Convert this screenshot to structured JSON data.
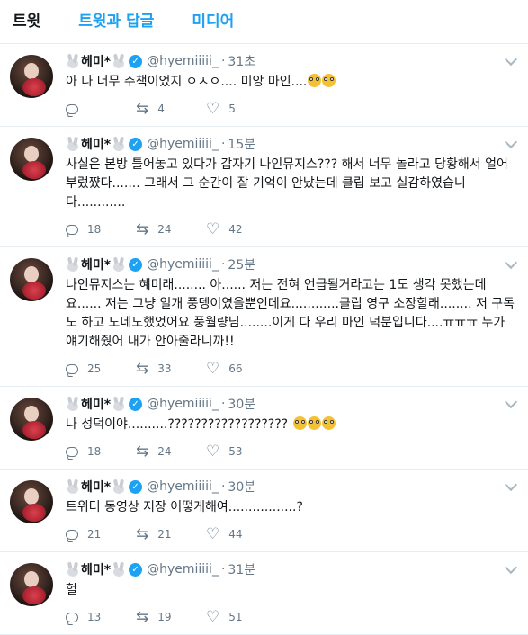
{
  "tabs": [
    "트윗",
    "트윗과 답글",
    "미디어"
  ],
  "user": {
    "name": "헤미*",
    "handle": "@hyemiiiii_"
  },
  "tweets": [
    {
      "time": "31초",
      "text": "아 나 너무 주책이었지 ㅇㅅㅇ.... 미앙 마인....",
      "emoji_count": 2,
      "replies": "",
      "retweets": "4",
      "likes": "5"
    },
    {
      "time": "15분",
      "text": "사실은 본방 틀어놓고 있다가 갑자기 나인뮤지스??? 해서 너무 놀라고 당황해서 얼어부렀쨨다....... 그래서 그 순간이 잘 기억이 안났는데 클립 보고 실감하였습니다............",
      "emoji_count": 0,
      "replies": "18",
      "retweets": "24",
      "likes": "42"
    },
    {
      "time": "25분",
      "text": "나인뮤지스는 혜미래........ 아...... 저는 전혀 언급될거라고는 1도 생각 못했는데요...... 저는 그냥 일개 풍뎅이였을뿐인데요............클립 영구 소장할래........ 저 구독도 하고 도네도했었어요 풍월량님........이게 다 우리 마인 덕분입니다....ㅠㅠㅠ 누가 얘기해줬어 내가 안아줄라니까!!",
      "emoji_count": 0,
      "replies": "25",
      "retweets": "33",
      "likes": "66"
    },
    {
      "time": "30분",
      "text": "나 성덕이야..........?????????????????? ",
      "emoji_count": 3,
      "replies": "18",
      "retweets": "24",
      "likes": "53"
    },
    {
      "time": "30분",
      "text": "트위터 동영상 저장 어떻게해여.................?",
      "emoji_count": 0,
      "replies": "21",
      "retweets": "21",
      "likes": "44"
    },
    {
      "time": "31분",
      "text": "헐",
      "emoji_count": 0,
      "replies": "13",
      "retweets": "19",
      "likes": "51"
    }
  ],
  "icons": {
    "reply": "reply-icon",
    "retweet": "retweet-icon",
    "like": "like-icon",
    "verified": "verified-icon",
    "caret": "chevron-down-icon"
  },
  "colors": {
    "accent": "#1da1f2",
    "muted": "#657786",
    "border": "#e6ecf0"
  }
}
